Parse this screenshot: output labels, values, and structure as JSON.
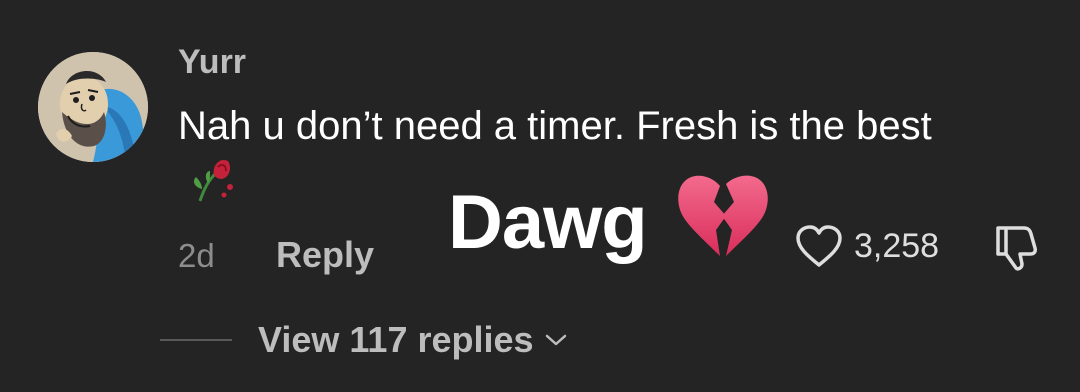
{
  "comment": {
    "username": "Yurr",
    "text": "Nah u don’t need a timer. Fresh is the best",
    "emoji_icon": "wilted-rose-icon",
    "time_ago": "2d",
    "reply_label": "Reply",
    "like_icon": "heart-outline-icon",
    "like_count": "3,258",
    "dislike_icon": "thumbs-down-icon"
  },
  "overlay": {
    "text": "Dawg",
    "emoji_icon": "broken-heart-icon"
  },
  "replies": {
    "label": "View 117 replies",
    "icon": "chevron-down-icon"
  },
  "colors": {
    "background": "#242424",
    "text_primary": "#ffffff",
    "text_secondary": "#bdbdbd",
    "text_muted": "#8d8d8d",
    "broken_heart": "#e8426e"
  }
}
